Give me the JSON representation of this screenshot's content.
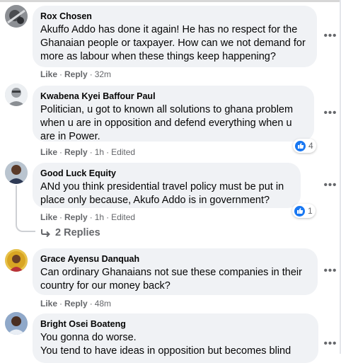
{
  "comments": [
    {
      "author": "Rox Chosen",
      "text": "Akuffo Addo has done it again! He has no respect for the Ghanaian people or taxpayer. How can we not demand for more as labour when these things keep happening?",
      "like": "Like",
      "reply": "Reply",
      "time": "32m"
    },
    {
      "author": "Kwabena Kyei Baffour Paul",
      "text": "Politician, u got to known all solutions to ghana problem when u are in opposition and defend everything when u are in Power.",
      "like": "Like",
      "reply": "Reply",
      "time": "1h",
      "edited": "Edited",
      "reactions": "4"
    },
    {
      "author": "Good Luck Equity",
      "text": "ANd you think presidential travel policy must be put in place only because, Akufo Addo is in government?",
      "like": "Like",
      "reply": "Reply",
      "time": "1h",
      "edited": "Edited",
      "reactions": "1",
      "replies_label": "2 Replies"
    },
    {
      "author": "Grace Ayensu Danquah",
      "text": "Can ordinary Ghanaians not sue these companies in their country for our money back?",
      "like": "Like",
      "reply": "Reply",
      "time": "48m"
    },
    {
      "author": "Bright Osei Boateng",
      "text": "You gonna do worse.\nYou tend to have ideas in opposition but becomes blind",
      "like": "Like",
      "reply": "Reply"
    }
  ],
  "colors": {
    "bubble": "#f0f2f5",
    "meta_text": "#65676b",
    "like_blue": "#1877f2"
  },
  "icons": {
    "more": "more-options-icon",
    "like": "like-thumb-icon",
    "reply_arrow": "reply-arrow-icon"
  }
}
